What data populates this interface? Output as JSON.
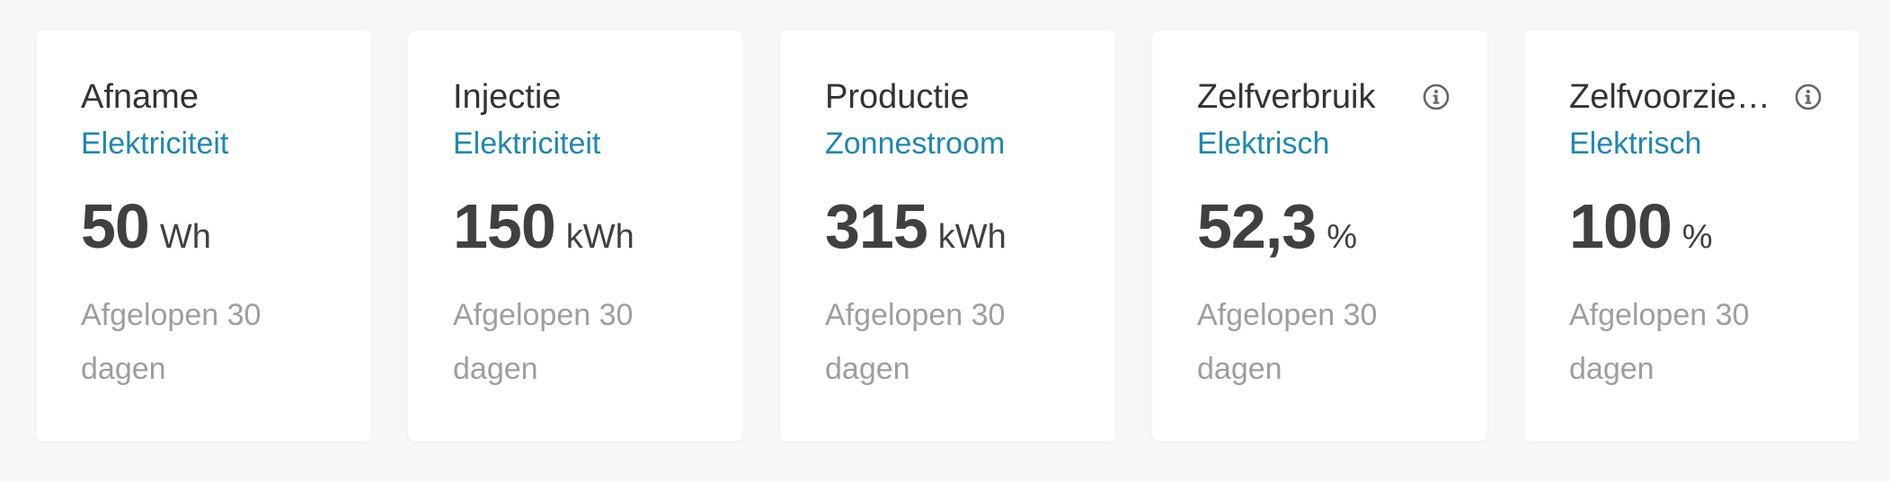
{
  "cards": [
    {
      "title": "Afname",
      "subtitle": "Elektriciteit",
      "value": "50",
      "unit": "Wh",
      "period": "Afgelopen 30 dagen",
      "has_info": false
    },
    {
      "title": "Injectie",
      "subtitle": "Elektriciteit",
      "value": "150",
      "unit": "kWh",
      "period": "Afgelopen 30 dagen",
      "has_info": false
    },
    {
      "title": "Productie",
      "subtitle": "Zonnestroom",
      "value": "315",
      "unit": "kWh",
      "period": "Afgelopen 30 dagen",
      "has_info": false
    },
    {
      "title": "Zelfverbruik",
      "subtitle": "Elektrisch",
      "value": "52,3",
      "unit": "%",
      "period": "Afgelopen 30 dagen",
      "has_info": true,
      "icon": "info-icon"
    },
    {
      "title": "Zelfvoorziening",
      "subtitle": "Elektrisch",
      "value": "100",
      "unit": "%",
      "period": "Afgelopen 30 dagen",
      "has_info": true,
      "icon": "info-icon"
    }
  ],
  "colors": {
    "background": "#f7f7f7",
    "card": "#ffffff",
    "title": "#333333",
    "subtitle": "#1f87b0",
    "value": "#404040",
    "period": "#9e9e9e",
    "icon": "#666666"
  }
}
